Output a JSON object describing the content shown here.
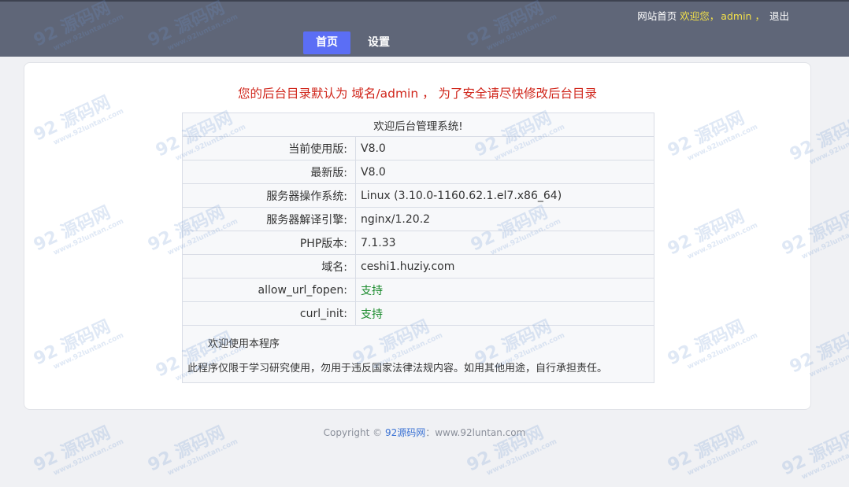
{
  "header": {
    "site_home": "网站首页",
    "welcome": "欢迎您，",
    "username": "admin",
    "separator": "，",
    "logout": "退出",
    "tabs": [
      {
        "label": "首页",
        "active": true
      },
      {
        "label": "设置",
        "active": false
      }
    ]
  },
  "notice": "您的后台目录默认为 域名/admin ， 为了安全请尽快修改后台目录",
  "info": {
    "title": "欢迎后台管理系统!",
    "rows": [
      {
        "label": "当前使用版:",
        "value": "V8.0"
      },
      {
        "label": "最新版:",
        "value": "V8.0"
      },
      {
        "label": "服务器操作系统:",
        "value": "Linux (3.10.0-1160.62.1.el7.x86_64)"
      },
      {
        "label": "服务器解译引擎:",
        "value": "nginx/1.20.2"
      },
      {
        "label": "PHP版本:",
        "value": "7.1.33"
      },
      {
        "label": "域名:",
        "value": "ceshi1.huziy.com"
      },
      {
        "label": "allow_url_fopen:",
        "value": "支持"
      },
      {
        "label": "curl_init:",
        "value": "支持"
      }
    ],
    "footer_title": "欢迎使用本程序",
    "footer_desc": "此程序仅限于学习研究使用，勿用于违反国家法律法规内容。如用其他用途，自行承担责任。"
  },
  "copyright": {
    "prefix": "Copyright © ",
    "site_name": "92源码网",
    "suffix": "：www.92luntan.com"
  },
  "watermark": {
    "mark": "92 源码网",
    "url": "www.92luntan.com"
  },
  "colors": {
    "header_bg": "#5f6678",
    "active_tab": "#5b6ef5",
    "notice": "#d0261b",
    "supported": "#188a2b",
    "highlight": "#f2e04a"
  }
}
